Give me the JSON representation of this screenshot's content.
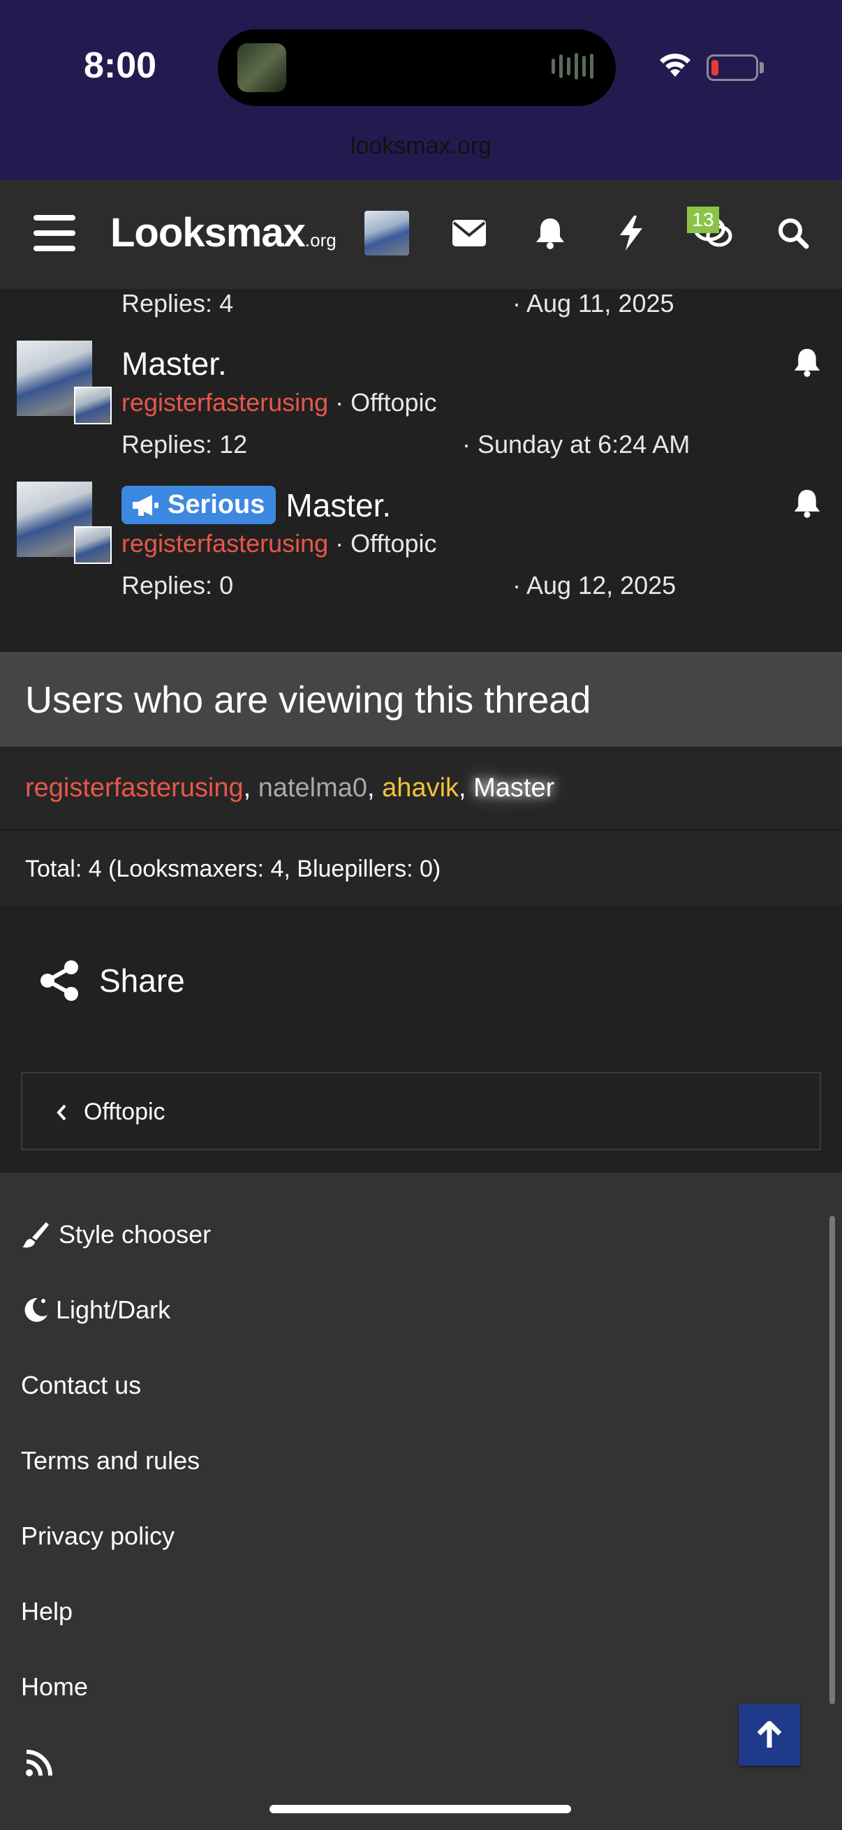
{
  "status_bar": {
    "time": "8:00",
    "url": "looksmax.org"
  },
  "header": {
    "logo_main": "Looksmax",
    "logo_domain": ".org",
    "alerts_badge": "13",
    "icons": [
      "menu-icon",
      "avatar",
      "envelope-icon",
      "bell-icon",
      "bolt-icon",
      "chat-icon",
      "search-icon"
    ]
  },
  "threads": [
    {
      "replies": "Replies: 4",
      "date": "· Aug 11, 2025"
    },
    {
      "title": "Master.",
      "author": "registerfasterusing",
      "forum": "· Offtopic",
      "replies": "Replies: 12",
      "date": "· Sunday at 6:24 AM"
    },
    {
      "prefix": "Serious",
      "title": "Master.",
      "author": "registerfasterusing",
      "forum": "· Offtopic",
      "replies": "Replies: 0",
      "date": "· Aug 12, 2025"
    }
  ],
  "viewers": {
    "heading": "Users who are viewing this thread",
    "names": [
      "registerfasterusing",
      "natelma0",
      "ahavik",
      "Master"
    ],
    "separator": ",",
    "total": "Total: 4 (Looksmaxers: 4, Bluepillers: 0)"
  },
  "share_label": "Share",
  "breadcrumb_back": "Offtopic",
  "footer": {
    "links": [
      "Style chooser",
      "Light/Dark",
      "Contact us",
      "Terms and rules",
      "Privacy policy",
      "Help",
      "Home"
    ]
  },
  "colors": {
    "accent_red": "#e7574a",
    "prefix_blue": "#3d88e0",
    "badge_green": "#8bc34a",
    "status_bar": "#231b4f"
  }
}
